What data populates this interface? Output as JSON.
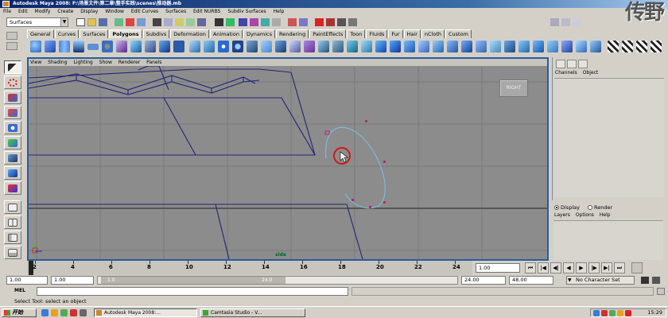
{
  "window": {
    "title": "Autodesk Maya 2008: F:\\场景文件\\第二章\\整手实践\\scenes\\推动器.mb"
  },
  "watermark": "传野",
  "menubar": [
    "File",
    "Edit",
    "Modify",
    "Create",
    "Display",
    "Window",
    "Edit Curves",
    "Surfaces",
    "Edit NURBS",
    "Subdiv Surfaces",
    "Help"
  ],
  "status_line": {
    "menu_set": "Surfaces"
  },
  "shelf_tabs": [
    {
      "label": "General"
    },
    {
      "label": "Curves"
    },
    {
      "label": "Surfaces"
    },
    {
      "label": "Polygons",
      "active": true
    },
    {
      "label": "Subdivs"
    },
    {
      "label": "Deformation"
    },
    {
      "label": "Animation"
    },
    {
      "label": "Dynamics"
    },
    {
      "label": "Rendering"
    },
    {
      "label": "PaintEffects"
    },
    {
      "label": "Toon"
    },
    {
      "label": "Fluids"
    },
    {
      "label": "Fur"
    },
    {
      "label": "Hair"
    },
    {
      "label": "nCloth"
    },
    {
      "label": "Custom"
    }
  ],
  "viewport": {
    "panel_menu": [
      "View",
      "Shading",
      "Lighting",
      "Show",
      "Renderer",
      "Panels"
    ],
    "view_cube_label": "RIGHT",
    "camera_label": "side"
  },
  "channel_box": {
    "menu": [
      "Channels",
      "Object"
    ]
  },
  "layer_editor": {
    "display_label": "Display",
    "render_label": "Render",
    "menu": [
      "Layers",
      "Options",
      "Help"
    ]
  },
  "time_slider": {
    "ticks": [
      "2",
      "4",
      "6",
      "8",
      "10",
      "12",
      "14",
      "16",
      "18",
      "20",
      "22",
      "24"
    ],
    "current_frame": "1.00"
  },
  "range_slider": {
    "start_time": "1.00",
    "playback_start": "1.00",
    "slider_start_label": "1.0",
    "slider_end_label": "24.0",
    "playback_end": "24.00",
    "end_time": "48.00",
    "character_set": "No Character Set"
  },
  "command_line": {
    "label": "MEL"
  },
  "help_line": {
    "text": "Select Tool: select an object"
  },
  "taskbar": {
    "start_label": "开始",
    "tasks": [
      {
        "label": "Autodesk Maya 2008:...",
        "active": true
      },
      {
        "label": "Camtasia Studio - V...",
        "active": false
      }
    ],
    "clock": "15:29"
  }
}
